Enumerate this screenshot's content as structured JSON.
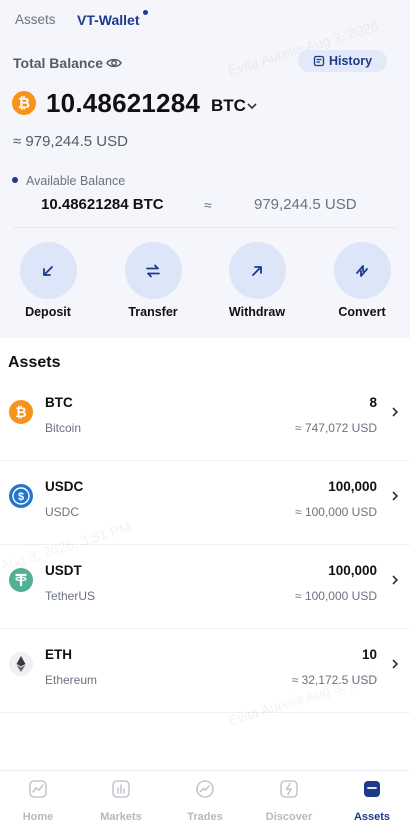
{
  "tabs": [
    {
      "label": "Assets",
      "active": false
    },
    {
      "label": "VT-Wallet",
      "active": true
    }
  ],
  "balance": {
    "label": "Total Balance",
    "history_label": "History",
    "amount": "10.48621284",
    "unit": "BTC",
    "approx_usd": "≈ 979,244.5 USD"
  },
  "available": {
    "label": "Available Balance",
    "btc": "10.48621284 BTC",
    "approx": "≈",
    "usd": "979,244.5 USD"
  },
  "actions": [
    {
      "label": "Deposit",
      "icon": "arrow-down-left-icon"
    },
    {
      "label": "Transfer",
      "icon": "swap-icon"
    },
    {
      "label": "Withdraw",
      "icon": "arrow-up-right-icon"
    },
    {
      "label": "Convert",
      "icon": "convert-icon"
    }
  ],
  "assets_title": "Assets",
  "assets": [
    {
      "symbol": "BTC",
      "name": "Bitcoin",
      "amount": "8",
      "usd": "≈ 747,072 USD",
      "icon": "bitcoin-icon",
      "color": "#f7931a"
    },
    {
      "symbol": "USDC",
      "name": "USDC",
      "amount": "100,000",
      "usd": "≈ 100,000 USD",
      "icon": "usdc-icon",
      "color": "#2775ca"
    },
    {
      "symbol": "USDT",
      "name": "TetherUS",
      "amount": "100,000",
      "usd": "≈ 100,000 USD",
      "icon": "tether-icon",
      "color": "#50af95"
    },
    {
      "symbol": "ETH",
      "name": "Ethereum",
      "amount": "10",
      "usd": "≈ 32,172.5 USD",
      "icon": "ethereum-icon",
      "color": "#3c3c3d"
    }
  ],
  "nav": [
    {
      "label": "Home",
      "icon": "home-icon",
      "active": false
    },
    {
      "label": "Markets",
      "icon": "markets-icon",
      "active": false
    },
    {
      "label": "Trades",
      "icon": "trades-icon",
      "active": false
    },
    {
      "label": "Discover",
      "icon": "discover-icon",
      "active": false
    },
    {
      "label": "Assets",
      "icon": "assets-icon",
      "active": true
    }
  ],
  "watermark": {
    "name": "Evita Aurelia Aug 3, 2026",
    "time": "Aug 3, 2026, 3:51 PM"
  },
  "colors": {
    "accent": "#1e3a8a",
    "action_bg": "#dde6f8",
    "page_bg": "#f4f6fb"
  }
}
